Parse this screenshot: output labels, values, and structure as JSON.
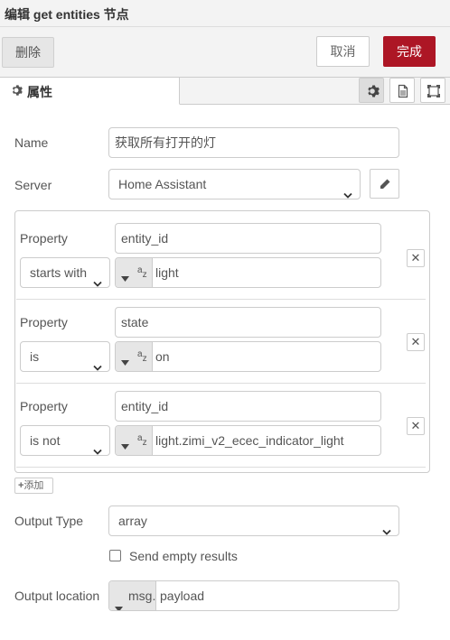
{
  "header": {
    "title": "编辑 get entities 节点"
  },
  "toolbar": {
    "delete_label": "删除",
    "cancel_label": "取消",
    "done_label": "完成",
    "done_color": "#ad1625"
  },
  "tabs": {
    "properties_label": "属性",
    "icons": [
      "gear-icon",
      "description-icon",
      "appearance-icon"
    ]
  },
  "form": {
    "name_label": "Name",
    "name_value": "获取所有打开的灯",
    "server_label": "Server",
    "server_value": "Home Assistant",
    "output_type_label": "Output Type",
    "output_type_value": "array",
    "send_empty_label": "Send empty results",
    "send_empty_checked": false,
    "output_location_label": "Output location",
    "output_location_prefix": "msg.",
    "output_location_value": "payload",
    "add_label": "添加"
  },
  "rules": [
    {
      "property_label": "Property",
      "property": "entity_id",
      "operator": "starts with",
      "value_type": "az",
      "value": "light"
    },
    {
      "property_label": "Property",
      "property": "state",
      "operator": "is",
      "value_type": "az",
      "value": "on"
    },
    {
      "property_label": "Property",
      "property": "entity_id",
      "operator": "is not",
      "value_type": "az",
      "value": "light.zimi_v2_ecec_indicator_light"
    }
  ]
}
